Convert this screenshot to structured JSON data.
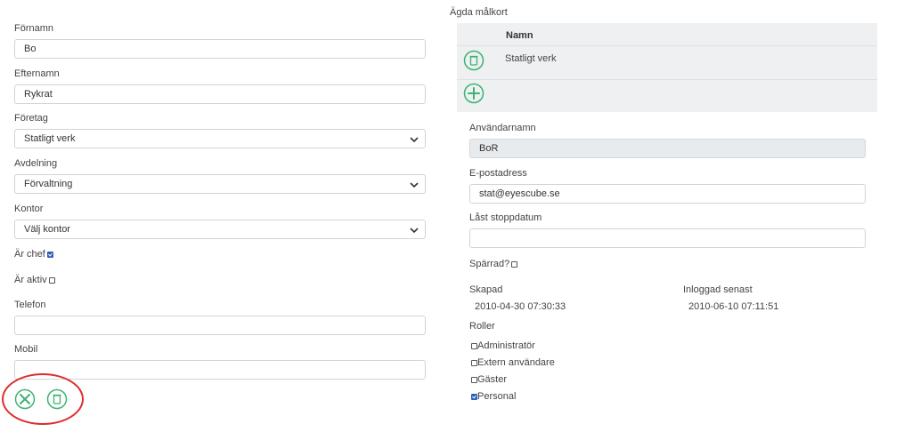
{
  "left": {
    "first_name": {
      "label": "Förnamn",
      "value": "Bo"
    },
    "last_name": {
      "label": "Efternamn",
      "value": "Rykrat"
    },
    "company": {
      "label": "Företag",
      "value": "Statligt verk"
    },
    "department": {
      "label": "Avdelning",
      "value": "Förvaltning"
    },
    "office": {
      "label": "Kontor",
      "value": "Välj kontor"
    },
    "is_chef": {
      "label": "Är chef",
      "checked": true
    },
    "is_active": {
      "label": "Är aktiv",
      "checked": false
    },
    "phone": {
      "label": "Telefon",
      "value": ""
    },
    "mobile": {
      "label": "Mobil",
      "value": ""
    }
  },
  "right": {
    "owned_cards": {
      "title": "Ägda målkort",
      "column_header": "Namn",
      "rows": [
        {
          "name": "Statligt verk"
        }
      ]
    },
    "username": {
      "label": "Användarnamn",
      "value": "BoR"
    },
    "email": {
      "label": "E-postadress",
      "value": "stat@eyescube.se"
    },
    "lock_stop_date": {
      "label": "Låst stoppdatum",
      "value": ""
    },
    "blocked": {
      "label": "Spärrad?",
      "checked": false
    },
    "created": {
      "label": "Skapad",
      "value": "2010-04-30 07:30:33"
    },
    "last_login": {
      "label": "Inloggad senast",
      "value": "2010-06-10 07:11:51"
    },
    "roles": {
      "title": "Roller",
      "items": [
        {
          "label": "Administratör",
          "checked": false
        },
        {
          "label": "Extern användare",
          "checked": false
        },
        {
          "label": "Gäster",
          "checked": false
        },
        {
          "label": "Personal",
          "checked": true
        }
      ]
    }
  },
  "icons": {
    "cancel": "x-circle-icon",
    "delete": "trash-icon",
    "add": "plus-circle-icon"
  },
  "colors": {
    "icon_green": "#3cb371",
    "annotation_red": "#e02a2a",
    "checkbox_blue": "#2f5fb8"
  }
}
